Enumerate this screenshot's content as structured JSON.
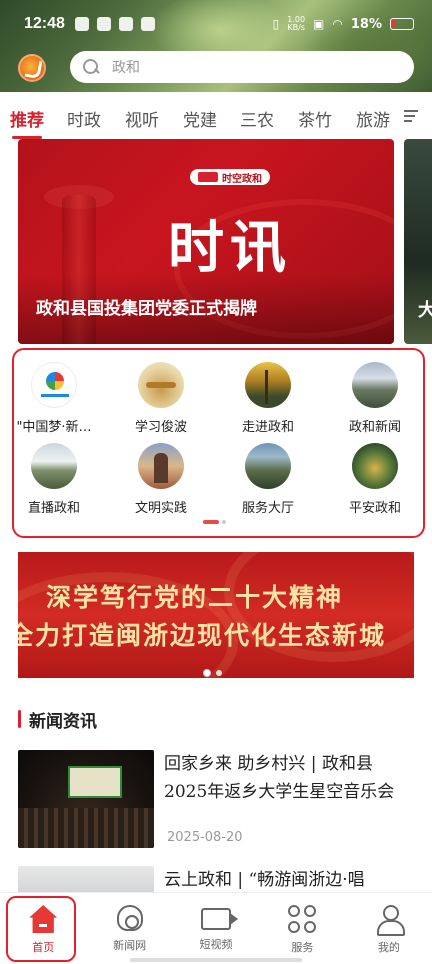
{
  "status_bar": {
    "time": "12:48",
    "net_speed_value": "1.00",
    "net_speed_unit": "KB/s",
    "battery": "18%"
  },
  "search": {
    "placeholder": "政和"
  },
  "tabs": [
    "推荐",
    "时政",
    "视听",
    "党建",
    "三农",
    "茶竹",
    "旅游"
  ],
  "banner": {
    "badge_text": "时空政和",
    "big_title": "时讯",
    "caption": "政和县国投集团党委正式揭牌",
    "next_peek": "大"
  },
  "grid": {
    "items": [
      {
        "label": "\"中国梦·新…",
        "icon": "zhongguomeng-icon"
      },
      {
        "label": "学习俊波",
        "icon": "xuexi-junbo-icon"
      },
      {
        "label": "走进政和",
        "icon": "zoujin-zhenghe-icon"
      },
      {
        "label": "政和新闻",
        "icon": "zhenghe-news-icon"
      },
      {
        "label": "直播政和",
        "icon": "live-zhenghe-icon"
      },
      {
        "label": "文明实践",
        "icon": "wenming-shijian-icon"
      },
      {
        "label": "服务大厅",
        "icon": "service-hall-icon"
      },
      {
        "label": "平安政和",
        "icon": "pingan-zhenghe-icon"
      }
    ]
  },
  "banner2": {
    "line1": "深学笃行党的二十大精神",
    "line2": "全力打造闽浙边现代化生态新城"
  },
  "news_section": {
    "title": "新闻资讯"
  },
  "news": [
    {
      "title": "回家乡来 助乡村兴 | 政和县2025年返乡大学生星空音乐会",
      "date": "2025-08-20"
    },
    {
      "title": "云上政和 | “畅游闽浙边·唱",
      "date": ""
    }
  ],
  "bottom_nav": [
    {
      "label": "首页",
      "icon": "home-icon"
    },
    {
      "label": "新闻网",
      "icon": "news-network-icon"
    },
    {
      "label": "短视频",
      "icon": "short-video-icon"
    },
    {
      "label": "服务",
      "icon": "service-icon"
    },
    {
      "label": "我的",
      "icon": "profile-icon"
    }
  ],
  "colors": {
    "accent": "#d6232f",
    "highlight_border": "#e3202b"
  }
}
